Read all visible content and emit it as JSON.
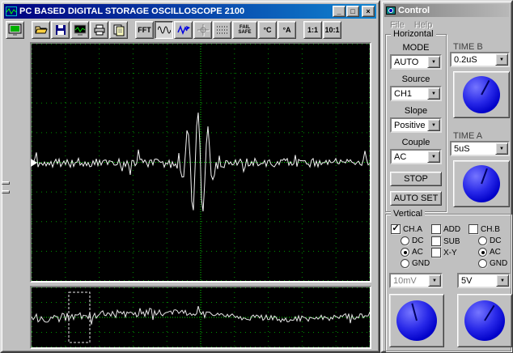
{
  "glyphs": {
    "check": "✓",
    "dropdown_arrow": "▼",
    "minimize": "_",
    "maximize": "□",
    "close": "×"
  },
  "main_window": {
    "title": "PC BASED DIGITAL STORAGE OSCILLOSCOPE 2100",
    "toolbar": {
      "icons": [
        "monitor",
        "open-folder",
        "save",
        "capture-screen",
        "printer",
        "notes",
        "fft",
        "sine-wave",
        "zigzag-arrow",
        "crosshair",
        "dotted-lines",
        "fail-safe",
        "deg-c",
        "deg-a",
        "ratio-1-1",
        "ratio-10-1"
      ],
      "fft": "FFT",
      "fail": "FAIL",
      "safe": "SAFE",
      "deg_c": "°C",
      "deg_a": "°A",
      "ratio_1_1": "1:1",
      "ratio_10_1": "10:1"
    }
  },
  "control_window": {
    "title": "Control",
    "menu": {
      "file": "File",
      "help": "Help"
    },
    "horizontal": {
      "group_label": "Horizontal",
      "mode_label": "MODE",
      "mode_value": "AUTO",
      "source_label": "Source",
      "source_value": "CH1",
      "slope_label": "Slope",
      "slope_value": "Positive",
      "couple_label": "Couple",
      "couple_value": "AC",
      "stop": "STOP",
      "auto_set": "AUTO SET"
    },
    "time_b": {
      "label": "TIME B",
      "value": "0.2uS"
    },
    "time_a": {
      "label": "TIME A",
      "value": "5uS"
    },
    "vertical": {
      "group_label": "Vertical",
      "ch_a": "CH.A",
      "add": "ADD",
      "ch_b": "CH.B",
      "sub": "SUB",
      "xy": "X-Y",
      "dc_a": "DC",
      "ac_a": "AC",
      "gnd_a": "GND",
      "dc_b": "DC",
      "ac_b": "AC",
      "gnd_b": "GND",
      "volts_a": "10mV",
      "volts_b": "5V"
    }
  }
}
